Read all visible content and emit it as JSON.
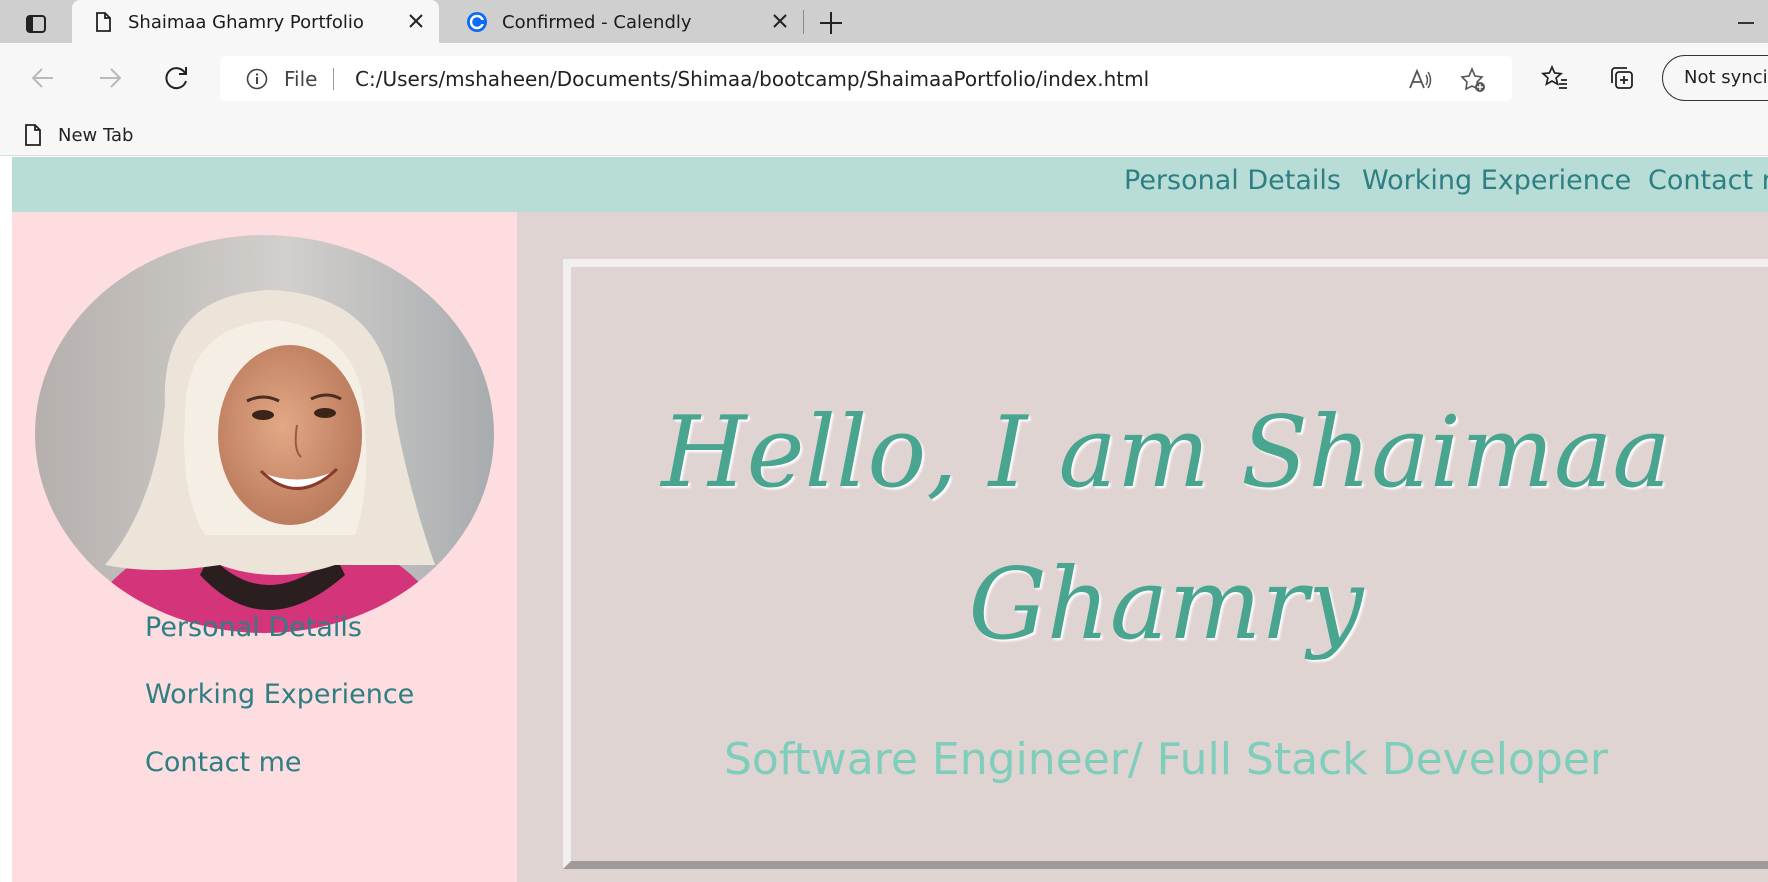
{
  "browser": {
    "tabs": [
      {
        "title": "Shaimaa Ghamry Portfolio",
        "active": true,
        "icon": "page-icon"
      },
      {
        "title": "Confirmed - Calendly",
        "active": false,
        "icon": "calendly-icon"
      }
    ],
    "address": {
      "scheme_label": "File",
      "url": "C:/Users/mshaheen/Documents/Shimaa/bootcamp/ShaimaaPortfolio/index.html"
    },
    "profile_button": "Not syncing",
    "favorites": [
      {
        "label": "New Tab"
      }
    ]
  },
  "site": {
    "top_nav": [
      "Personal Details",
      "Working Experience",
      "Contact me"
    ],
    "side_nav": [
      "Personal Details",
      "Working Experience",
      "Contact me"
    ],
    "hero": {
      "title": "Hello, I am Shaimaa Ghamry",
      "subtitle": "Software Engineer/ Full Stack Developer"
    },
    "colors": {
      "nav_bg": "#b8ddd6",
      "sidebar_bg": "#fddddf",
      "main_bg": "#e0d4d3",
      "link": "#2e7f84",
      "title": "#4aa590",
      "subtitle": "#7fcdbb"
    }
  }
}
